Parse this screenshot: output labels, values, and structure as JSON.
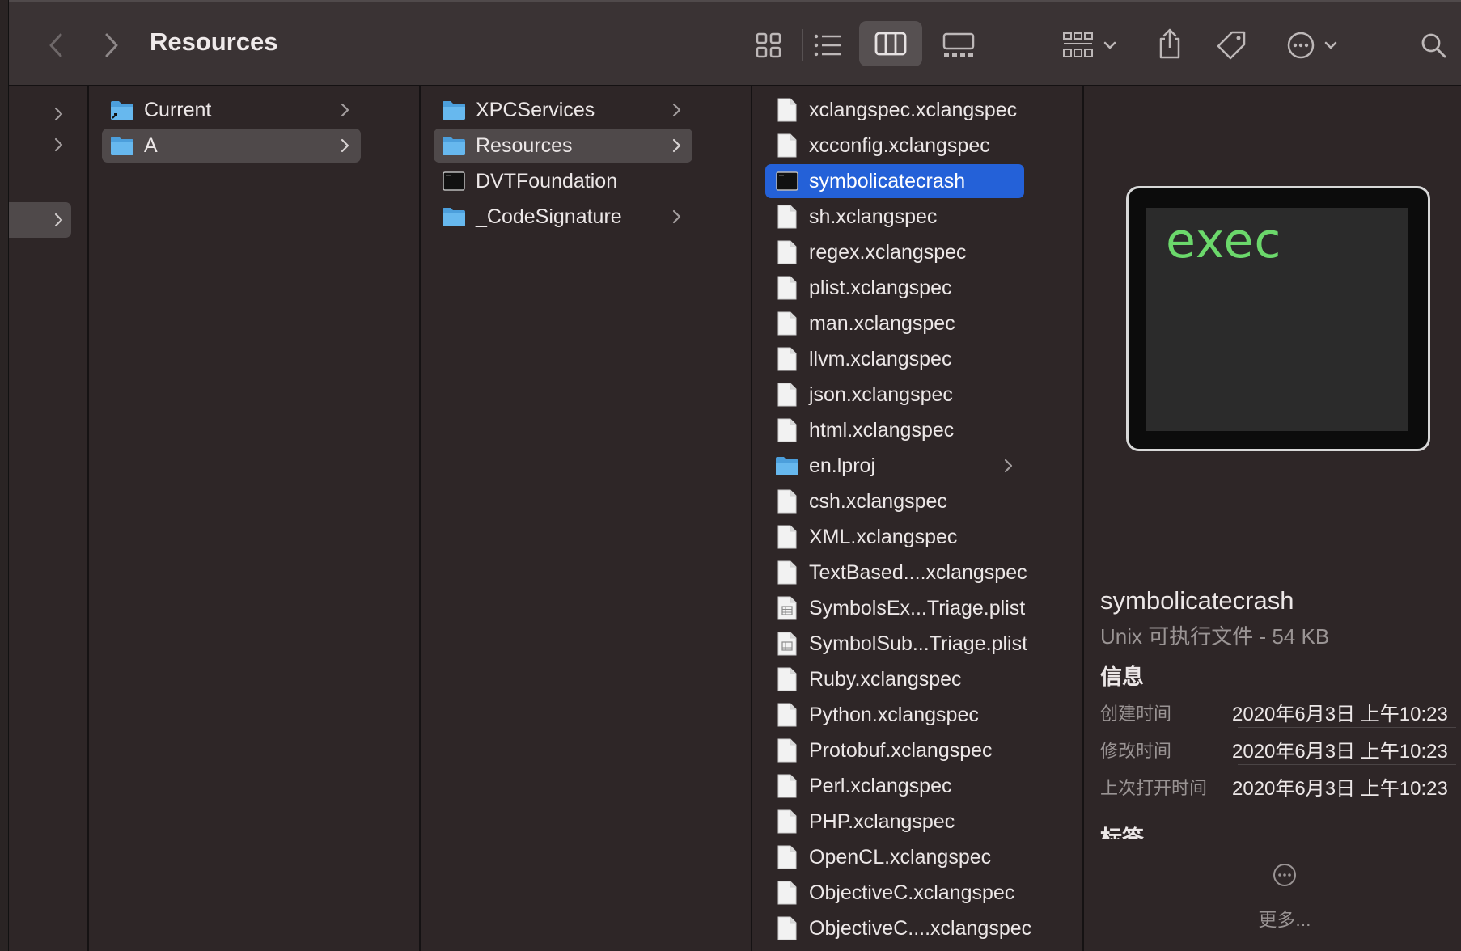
{
  "toolbar": {
    "title": "Resources",
    "back_icon": "chevron-left-icon",
    "forward_icon": "chevron-right-icon",
    "view_icons": [
      "grid-view-icon",
      "list-view-icon",
      "column-view-icon",
      "gallery-view-icon"
    ],
    "active_view": "column-view-icon",
    "tools": [
      "group-by-icon",
      "share-icon",
      "tag-icon",
      "more-actions-icon",
      "search-icon"
    ]
  },
  "columns": {
    "col1": {
      "items": [
        {
          "name": "Current",
          "type": "folder-alias",
          "has_children": true
        },
        {
          "name": "A",
          "type": "folder",
          "has_children": true,
          "selected": true
        }
      ]
    },
    "col2": {
      "items": [
        {
          "name": "XPCServices",
          "type": "folder",
          "has_children": true
        },
        {
          "name": "Resources",
          "type": "folder",
          "has_children": true,
          "selected": true
        },
        {
          "name": "DVTFoundation",
          "type": "executable",
          "has_children": false
        },
        {
          "name": "_CodeSignature",
          "type": "folder",
          "has_children": true
        }
      ]
    },
    "col3": {
      "items": [
        {
          "name": "xclangspec.xclangspec",
          "type": "file"
        },
        {
          "name": "xcconfig.xclangspec",
          "type": "file"
        },
        {
          "name": "symbolicatecrash",
          "type": "executable",
          "selected": true
        },
        {
          "name": "sh.xclangspec",
          "type": "file"
        },
        {
          "name": "regex.xclangspec",
          "type": "file"
        },
        {
          "name": "plist.xclangspec",
          "type": "file"
        },
        {
          "name": "man.xclangspec",
          "type": "file"
        },
        {
          "name": "llvm.xclangspec",
          "type": "file"
        },
        {
          "name": "json.xclangspec",
          "type": "file"
        },
        {
          "name": "html.xclangspec",
          "type": "file"
        },
        {
          "name": "en.lproj",
          "type": "folder",
          "has_children": true
        },
        {
          "name": "csh.xclangspec",
          "type": "file"
        },
        {
          "name": "XML.xclangspec",
          "type": "file"
        },
        {
          "name": "TextBased....xclangspec",
          "type": "file"
        },
        {
          "name": "SymbolsEx...Triage.plist",
          "type": "plist"
        },
        {
          "name": "SymbolSub...Triage.plist",
          "type": "plist"
        },
        {
          "name": "Ruby.xclangspec",
          "type": "file"
        },
        {
          "name": "Python.xclangspec",
          "type": "file"
        },
        {
          "name": "Protobuf.xclangspec",
          "type": "file"
        },
        {
          "name": "Perl.xclangspec",
          "type": "file"
        },
        {
          "name": "PHP.xclangspec",
          "type": "file"
        },
        {
          "name": "OpenCL.xclangspec",
          "type": "file"
        },
        {
          "name": "ObjectiveC.xclangspec",
          "type": "file"
        },
        {
          "name": "ObjectiveC....xclangspec",
          "type": "file"
        }
      ]
    }
  },
  "preview": {
    "thumb_text": "exec",
    "name": "symbolicatecrash",
    "kind": "Unix 可执行文件 - 54 KB",
    "info_heading": "信息",
    "info": [
      {
        "label": "创建时间",
        "value": "2020年6月3日 上午10:23"
      },
      {
        "label": "修改时间",
        "value": "2020年6月3日 上午10:23"
      },
      {
        "label": "上次打开时间",
        "value": "2020年6月3日 上午10:23"
      }
    ],
    "tags_heading": "标签",
    "more_label": "更多..."
  },
  "colors": {
    "selection_blue": "#2461d8",
    "selection_gray": "#4f494a",
    "folder_blue": "#5aaee8",
    "exec_green": "#6bd86b"
  }
}
